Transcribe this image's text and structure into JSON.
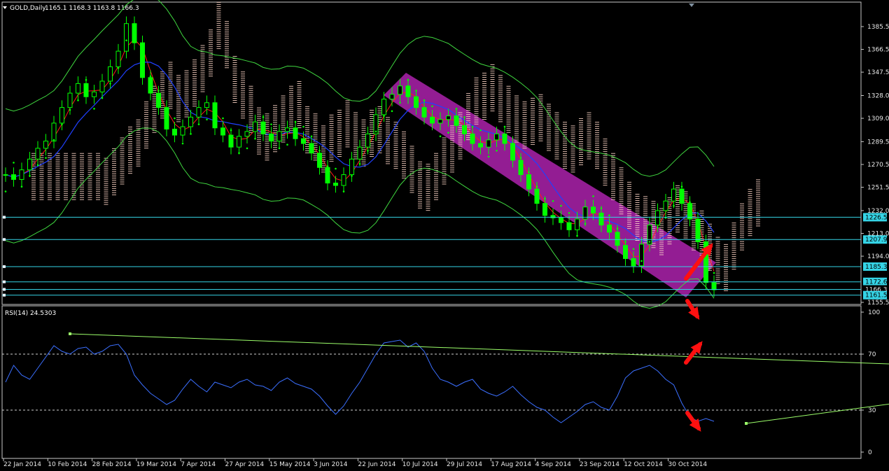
{
  "header": {
    "symbol": "GOLD,Daily",
    "ohlc": "1165.1 1168.3 1163.8 1166.3",
    "rsi_label": "RSI(14) 24.5303"
  },
  "colors": {
    "background": "#000000",
    "axis": "#c8c8c8",
    "candle": "#00ff00",
    "cloud": "#ffd8c8",
    "channel": "#a020a0",
    "rsi_line": "#3b6fff",
    "trend_line": "#9cff6a",
    "level_line": "#35d4e6",
    "arrow": "#ff1010",
    "ma_red": "#ff1a1a",
    "ma_blue": "#2040ff",
    "envelope": "#3fd63f",
    "sar": "#00ff00"
  },
  "chart_data": {
    "type": "line",
    "price_axis": {
      "ticks": [
        "1385.5",
        "1366.5",
        "1347.5",
        "1328.0",
        "1309.0",
        "1289.5",
        "1270.5",
        "1251.5",
        "1232.0",
        "1213.0",
        "1194.0",
        "1155.5"
      ],
      "range": [
        1150,
        1400
      ]
    },
    "price_tags": [
      "1226.5",
      "1207.9",
      "1185.3",
      "1172.6",
      "1166.3",
      "1161.5"
    ],
    "current_price_tag": "1166.3",
    "x_axis_labels": [
      "22 Jan 2014",
      "10 Feb 2014",
      "28 Feb 2014",
      "19 Mar 2014",
      "7 Apr 2014",
      "27 Apr 2014",
      "15 May 2014",
      "3 Jun 2014",
      "22 Jun 2014",
      "10 Jul 2014",
      "29 Jul 2014",
      "17 Aug 2014",
      "4 Sep 2014",
      "23 Sep 2014",
      "12 Oct 2014",
      "30 Oct 2014"
    ],
    "close_series": [
      1262,
      1258,
      1266,
      1275,
      1284,
      1290,
      1305,
      1318,
      1330,
      1338,
      1327,
      1331,
      1340,
      1352,
      1365,
      1388,
      1372,
      1343,
      1330,
      1318,
      1300,
      1295,
      1302,
      1310,
      1318,
      1322,
      1301,
      1295,
      1285,
      1294,
      1298,
      1306,
      1296,
      1290,
      1298,
      1301,
      1292,
      1288,
      1280,
      1268,
      1255,
      1253,
      1262,
      1275,
      1285,
      1296,
      1312,
      1325,
      1329,
      1336,
      1327,
      1318,
      1310,
      1305,
      1308,
      1311,
      1303,
      1296,
      1288,
      1285,
      1291,
      1296,
      1288,
      1274,
      1262,
      1250,
      1238,
      1228,
      1226,
      1222,
      1216,
      1225,
      1235,
      1230,
      1220,
      1214,
      1203,
      1192,
      1186,
      1204,
      1220,
      1232,
      1240,
      1250,
      1238,
      1225,
      1206,
      1172,
      1166
    ],
    "levels": [
      1226.5,
      1207.9,
      1185.3,
      1172.6,
      1166.3,
      1161.5
    ],
    "rsi_axis": {
      "ticks": [
        "100",
        "70",
        "30",
        "0"
      ],
      "range": [
        0,
        100
      ]
    },
    "rsi_series": [
      50,
      62,
      55,
      52,
      60,
      68,
      76,
      72,
      70,
      74,
      75,
      70,
      72,
      76,
      77,
      70,
      55,
      48,
      42,
      38,
      34,
      37,
      45,
      52,
      47,
      43,
      50,
      48,
      46,
      50,
      52,
      48,
      47,
      44,
      50,
      53,
      49,
      47,
      45,
      40,
      33,
      27,
      33,
      42,
      50,
      60,
      70,
      78,
      79,
      80,
      75,
      78,
      72,
      60,
      52,
      50,
      47,
      50,
      52,
      45,
      42,
      40,
      43,
      47,
      41,
      36,
      32,
      30,
      25,
      21,
      25,
      29,
      34,
      36,
      32,
      30,
      40,
      53,
      58,
      60,
      62,
      58,
      52,
      48,
      35,
      25,
      22,
      24,
      22
    ],
    "rsi_trend_upper": [
      [
        8,
        84.5
      ],
      [
        135,
        56
      ]
    ],
    "rsi_trend_lower": [
      [
        92,
        20.5
      ],
      [
        135,
        56
      ]
    ]
  }
}
